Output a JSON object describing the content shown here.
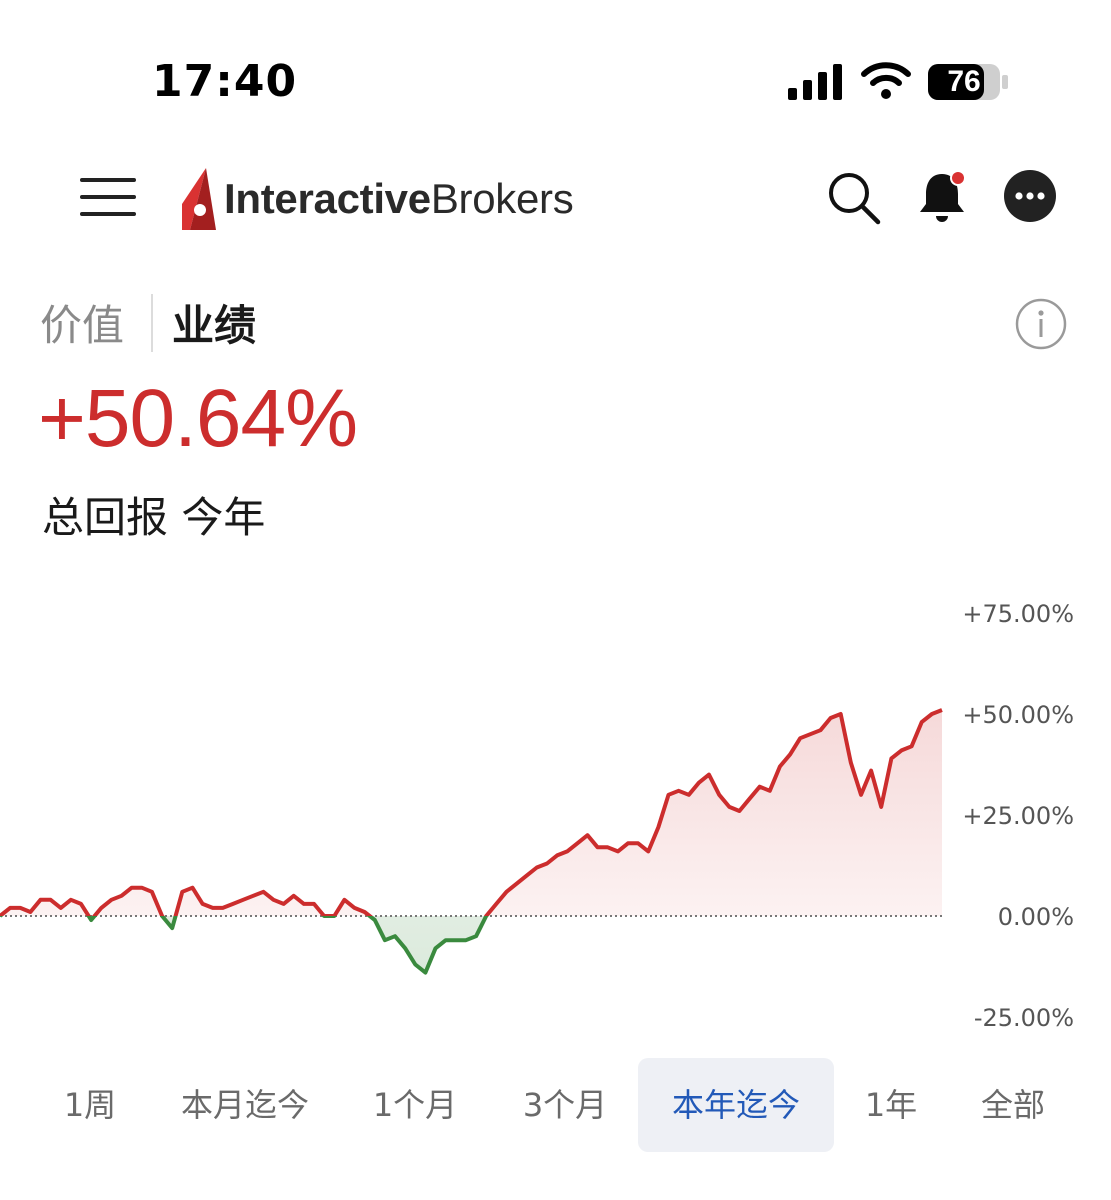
{
  "status": {
    "time": "17:40",
    "battery": "76"
  },
  "header": {
    "brand_bold": "Interactive",
    "brand_light": "Brokers"
  },
  "tabs": {
    "value": "价值",
    "performance": "业绩",
    "active": "performance"
  },
  "summary": {
    "value": "+50.64%",
    "label": "总回报 今年"
  },
  "colors": {
    "positive": "#cc2d2d",
    "negative": "#3a8a3e",
    "accent": "#2259b8"
  },
  "range": {
    "items": [
      "1周",
      "本月迄今",
      "1个月",
      "3个月",
      "本年迄今",
      "1年",
      "全部"
    ],
    "active_index": 4
  },
  "chart_data": {
    "type": "area",
    "ylim": [
      -30,
      78
    ],
    "y_ticks": [
      75,
      50,
      25,
      0,
      -25
    ],
    "y_tick_labels": [
      "+75.00%",
      "+50.00%",
      "+25.00%",
      "0.00%",
      "-25.00%"
    ],
    "baseline": 0,
    "values": [
      0,
      2,
      2,
      1,
      4,
      4,
      2,
      4,
      3,
      -1,
      2,
      4,
      5,
      7,
      7,
      6,
      0,
      -3,
      6,
      7,
      3,
      2,
      2,
      3,
      4,
      5,
      6,
      4,
      3,
      5,
      3,
      3,
      0,
      0,
      4,
      2,
      1,
      -1,
      -6,
      -5,
      -8,
      -12,
      -14,
      -8,
      -6,
      -6,
      -6,
      -5,
      0,
      3,
      6,
      8,
      10,
      12,
      13,
      15,
      16,
      18,
      20,
      17,
      17,
      16,
      18,
      18,
      16,
      22,
      30,
      31,
      30,
      33,
      35,
      30,
      27,
      26,
      29,
      32,
      31,
      37,
      40,
      44,
      45,
      46,
      49,
      50,
      38,
      30,
      36,
      27,
      39,
      41,
      42,
      48,
      50,
      51
    ],
    "grid": false,
    "legend": "none"
  }
}
